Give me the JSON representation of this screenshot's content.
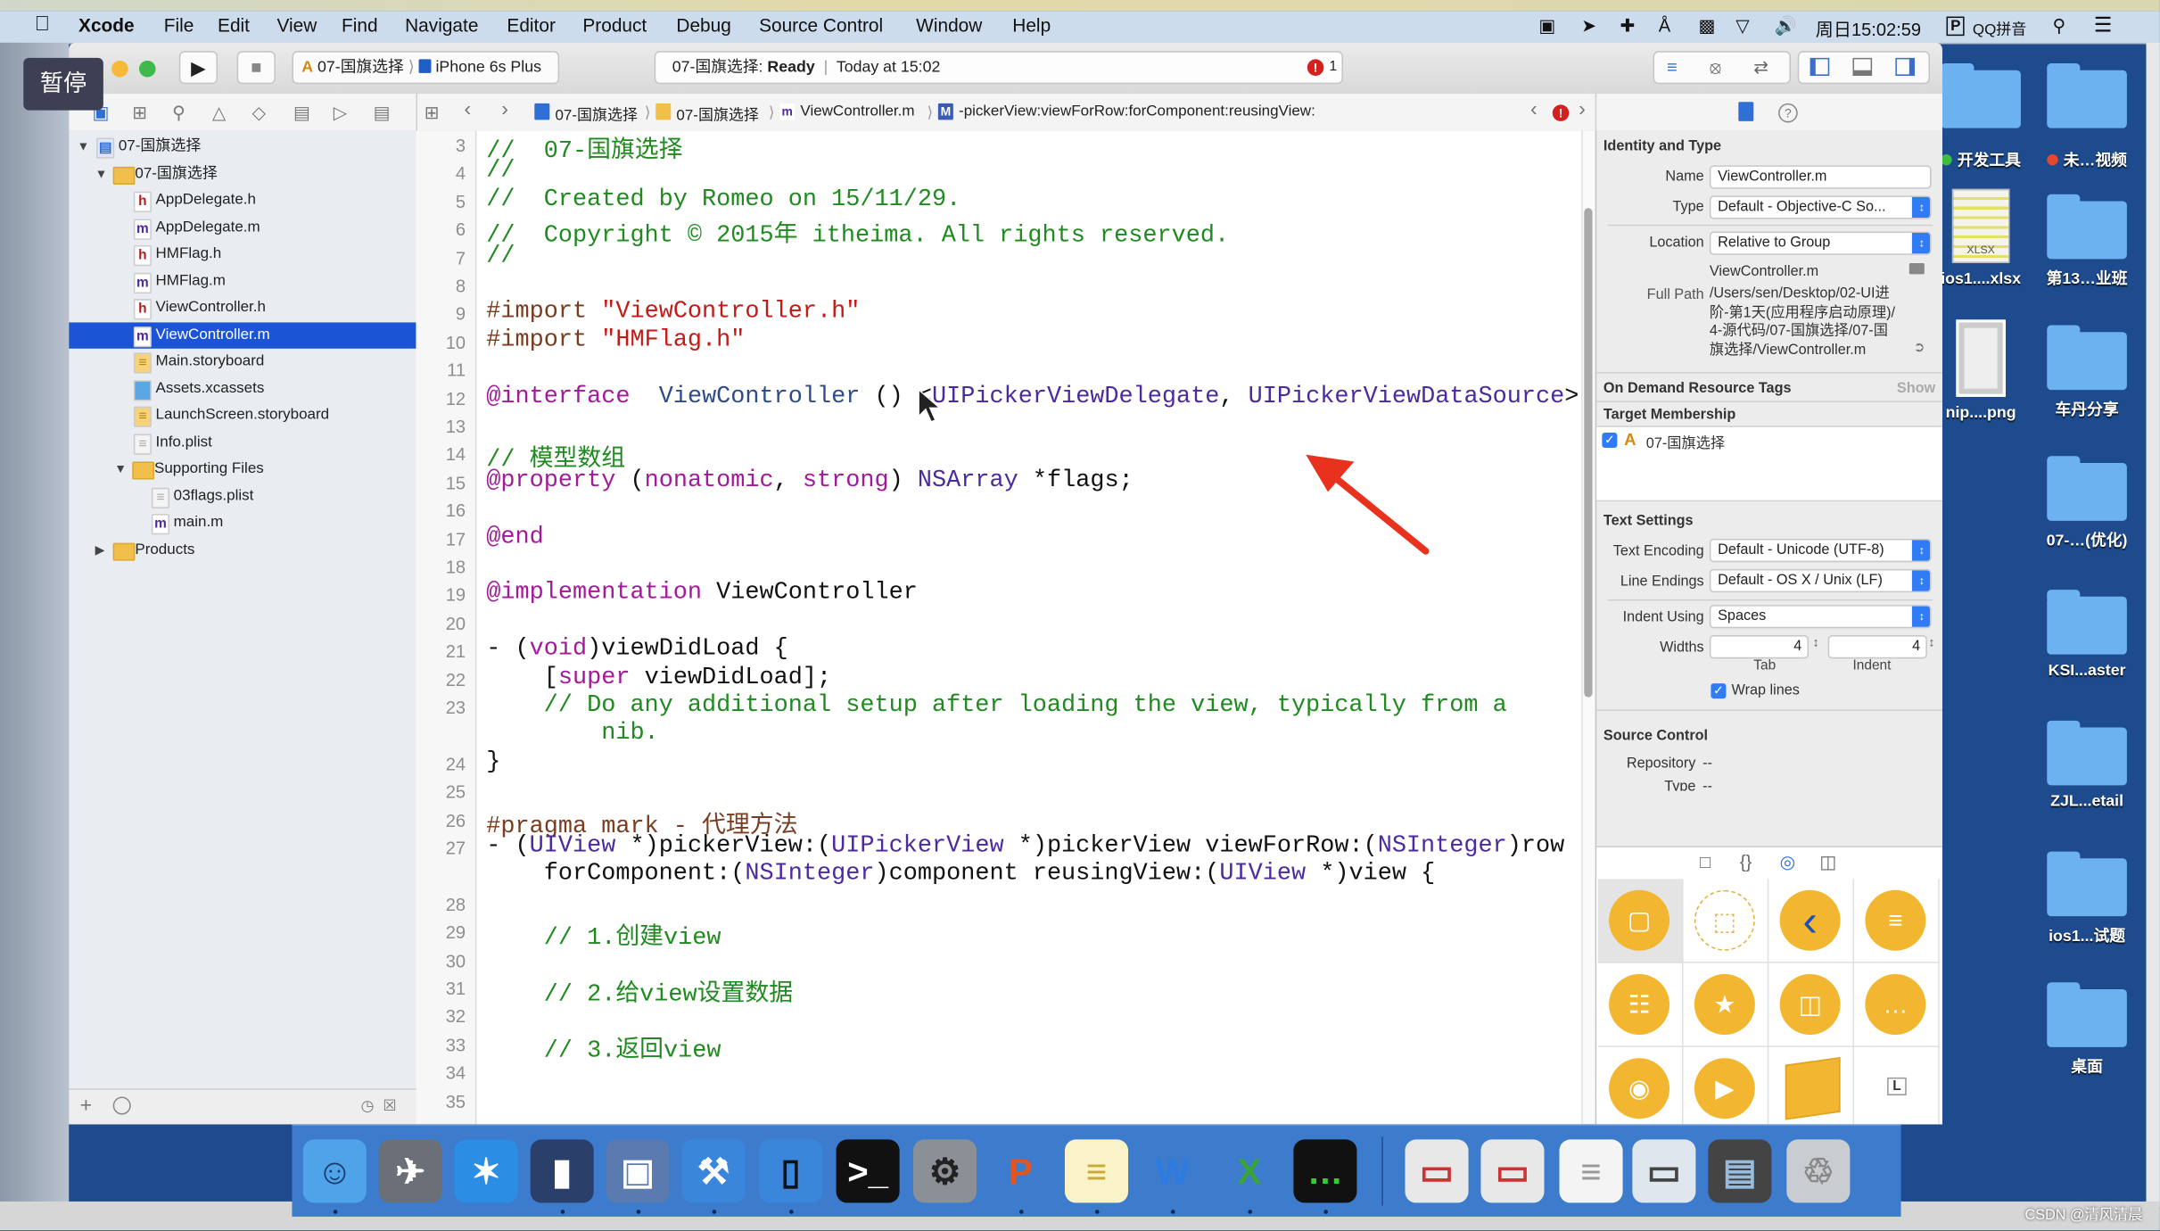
{
  "overlay": {
    "pause_label": "暂停"
  },
  "menubar": {
    "apple": "",
    "items": [
      "Xcode",
      "File",
      "Edit",
      "View",
      "Find",
      "Navigate",
      "Editor",
      "Product",
      "Debug",
      "Source Control",
      "Window",
      "Help"
    ],
    "status_icons": [
      "screen-record-icon",
      "location-icon",
      "airplane-icon",
      "bluetooth-icon",
      "lock-icon",
      "wifi-icon",
      "volume-icon"
    ],
    "clock": "周日15:02:59",
    "input_method_badge": "P",
    "input_method": "QQ拼音",
    "search_icon": "search-icon",
    "list_icon": "notification-list-icon"
  },
  "toolbar": {
    "scheme": "07-国旗选择",
    "device": "iPhone 6s Plus",
    "status_project": "07-国旗选择:",
    "status_state": "Ready",
    "status_time": "Today at 15:02",
    "error_count": "1"
  },
  "jumpbar": {
    "crumbs": [
      "07-国旗选择",
      "07-国旗选择",
      "ViewController.m",
      "-pickerView:viewForRow:forComponent:reusingView:"
    ],
    "method_badge": "M",
    "file_badge": "m"
  },
  "navigator": {
    "items": [
      {
        "label": "07-国旗选择",
        "kind": "project",
        "level": 0,
        "disclosure": "open"
      },
      {
        "label": "07-国旗选择",
        "kind": "folder",
        "level": 1,
        "disclosure": "open"
      },
      {
        "label": "AppDelegate.h",
        "kind": "h",
        "level": 2
      },
      {
        "label": "AppDelegate.m",
        "kind": "m",
        "level": 2
      },
      {
        "label": "HMFlag.h",
        "kind": "h",
        "level": 2
      },
      {
        "label": "HMFlag.m",
        "kind": "m",
        "level": 2
      },
      {
        "label": "ViewController.h",
        "kind": "h",
        "level": 2
      },
      {
        "label": "ViewController.m",
        "kind": "m",
        "level": 2,
        "selected": true
      },
      {
        "label": "Main.storyboard",
        "kind": "storyboard",
        "level": 2
      },
      {
        "label": "Assets.xcassets",
        "kind": "assets",
        "level": 2
      },
      {
        "label": "LaunchScreen.storyboard",
        "kind": "storyboard",
        "level": 2
      },
      {
        "label": "Info.plist",
        "kind": "plist",
        "level": 2
      },
      {
        "label": "Supporting Files",
        "kind": "folder",
        "level": 2,
        "disclosure": "open"
      },
      {
        "label": "03flags.plist",
        "kind": "plist",
        "level": 3
      },
      {
        "label": "main.m",
        "kind": "m",
        "level": 3
      },
      {
        "label": "Products",
        "kind": "folder",
        "level": 1,
        "disclosure": "closed"
      }
    ]
  },
  "editor": {
    "lines": [
      {
        "n": "3",
        "seg": [
          [
            "c",
            "//  07-国旗选择"
          ]
        ]
      },
      {
        "n": "4",
        "seg": [
          [
            "c",
            "//"
          ]
        ]
      },
      {
        "n": "5",
        "seg": [
          [
            "c",
            "//  Created by Romeo on 15/11/29."
          ]
        ]
      },
      {
        "n": "6",
        "seg": [
          [
            "c",
            "//  Copyright © 2015年 itheima. All rights reserved."
          ]
        ]
      },
      {
        "n": "7",
        "seg": [
          [
            "c",
            "//"
          ]
        ]
      },
      {
        "n": "8",
        "seg": []
      },
      {
        "n": "9",
        "seg": [
          [
            "p",
            "#import "
          ],
          [
            "s",
            "\"ViewController.h\""
          ]
        ]
      },
      {
        "n": "10",
        "seg": [
          [
            "p",
            "#import "
          ],
          [
            "s",
            "\"HMFlag.h\""
          ]
        ]
      },
      {
        "n": "11",
        "seg": []
      },
      {
        "n": "12",
        "seg": [
          [
            "k",
            "@interface"
          ],
          [
            "",
            "  "
          ],
          [
            "n",
            "ViewController"
          ],
          [
            "",
            " () <"
          ],
          [
            "t",
            "UIPickerViewDelegate"
          ],
          [
            "",
            ", "
          ],
          [
            "t",
            "UIPickerViewDataSource"
          ],
          [
            "",
            ">"
          ]
        ]
      },
      {
        "n": "13",
        "seg": []
      },
      {
        "n": "14",
        "seg": [
          [
            "c",
            "// 模型数组"
          ]
        ]
      },
      {
        "n": "15",
        "seg": [
          [
            "k",
            "@property"
          ],
          [
            "",
            " ("
          ],
          [
            "k",
            "nonatomic"
          ],
          [
            "",
            ", "
          ],
          [
            "k",
            "strong"
          ],
          [
            "",
            ") "
          ],
          [
            "t",
            "NSArray"
          ],
          [
            "",
            " *flags;"
          ]
        ]
      },
      {
        "n": "16",
        "seg": []
      },
      {
        "n": "17",
        "seg": [
          [
            "k",
            "@end"
          ]
        ]
      },
      {
        "n": "18",
        "seg": []
      },
      {
        "n": "19",
        "seg": [
          [
            "k",
            "@implementation"
          ],
          [
            "",
            " ViewController"
          ]
        ]
      },
      {
        "n": "20",
        "seg": []
      },
      {
        "n": "21",
        "seg": [
          [
            "",
            "- ("
          ],
          [
            "k",
            "void"
          ],
          [
            "",
            ")viewDidLoad {"
          ]
        ]
      },
      {
        "n": "22",
        "seg": [
          [
            "",
            "    ["
          ],
          [
            "k",
            "super"
          ],
          [
            "",
            " viewDidLoad];"
          ]
        ]
      },
      {
        "n": "23",
        "seg": [
          [
            "c",
            "    // Do any additional setup after loading the view, typically from a"
          ]
        ],
        "cont": [
          [
            "c",
            "        nib."
          ]
        ]
      },
      {
        "n": "24",
        "seg": [
          [
            "",
            "}"
          ]
        ]
      },
      {
        "n": "25",
        "seg": []
      },
      {
        "n": "26",
        "seg": [
          [
            "p",
            "#pragma mark - 代理方法"
          ]
        ]
      },
      {
        "n": "27",
        "seg": [
          [
            "",
            "- ("
          ],
          [
            "t",
            "UIView"
          ],
          [
            "",
            " *)pickerView:("
          ],
          [
            "t",
            "UIPickerView"
          ],
          [
            "",
            " *)pickerView viewForRow:("
          ],
          [
            "t",
            "NSInteger"
          ],
          [
            "",
            ")row"
          ]
        ],
        "cont": [
          [
            "",
            "    forComponent:("
          ],
          [
            "t",
            "NSInteger"
          ],
          [
            "",
            ")component reusingView:("
          ],
          [
            "t",
            "UIView"
          ],
          [
            "",
            " *)view {"
          ]
        ]
      },
      {
        "n": "28",
        "seg": []
      },
      {
        "n": "29",
        "seg": [
          [
            "c",
            "    // 1.创建view"
          ]
        ]
      },
      {
        "n": "30",
        "seg": []
      },
      {
        "n": "31",
        "seg": [
          [
            "c",
            "    // 2.给view设置数据"
          ]
        ]
      },
      {
        "n": "32",
        "seg": []
      },
      {
        "n": "33",
        "seg": [
          [
            "c",
            "    // 3.返回view"
          ]
        ]
      },
      {
        "n": "34",
        "seg": []
      },
      {
        "n": "35",
        "seg": []
      }
    ]
  },
  "inspector": {
    "identity_header": "Identity and Type",
    "name_label": "Name",
    "name_value": "ViewController.m",
    "type_label": "Type",
    "type_value": "Default - Objective-C So...",
    "location_label": "Location",
    "location_value": "Relative to Group",
    "location_file": "ViewController.m",
    "fullpath_label": "Full Path",
    "fullpath_lines": [
      "/Users/sen/Desktop/02-UI进",
      "阶-第1天(应用程序启动原理)/",
      "4-源代码/07-国旗选择/07-国",
      "旗选择/ViewController.m"
    ],
    "odr_header": "On Demand Resource Tags",
    "odr_show": "Show",
    "target_header": "Target Membership",
    "target_name": "07-国旗选择",
    "target_checked": true,
    "text_header": "Text Settings",
    "encoding_label": "Text Encoding",
    "encoding_value": "Default - Unicode (UTF-8)",
    "endings_label": "Line Endings",
    "endings_value": "Default - OS X / Unix (LF)",
    "indent_label": "Indent Using",
    "indent_value": "Spaces",
    "widths_label": "Widths",
    "tab_value": "4",
    "indent_width_value": "4",
    "tab_caption": "Tab",
    "indent_caption": "Indent",
    "wrap_label": "Wrap lines",
    "wrap_checked": true,
    "sc_header": "Source Control",
    "repo_label": "Repository",
    "repo_value": "--",
    "sctype_label": "Type",
    "sctype_value": "--",
    "library_items": [
      "view",
      "container-view",
      "back-navigation",
      "table-view",
      "collection-view",
      "tab-bar",
      "split-view",
      "page-view",
      "button",
      "media-player",
      "object",
      "label"
    ],
    "label_glyph": "L"
  },
  "desktop": {
    "items": [
      {
        "label": "",
        "kind": "folder",
        "col": 1
      },
      {
        "label": "",
        "kind": "folder",
        "col": 2
      },
      {
        "label": "开发工具",
        "tag": "#3fbf3f",
        "col": 1
      },
      {
        "label": "未…视频",
        "tag": "#e5482e",
        "col": 2
      },
      {
        "label": "ios1....xlsx",
        "kind": "xlsx",
        "col": 1,
        "badge": "XLSX"
      },
      {
        "label": "第13…业班",
        "kind": "folder",
        "col": 2
      },
      {
        "label": "nip....png",
        "kind": "png",
        "col": 1
      },
      {
        "label": "车丹分享",
        "kind": "folder",
        "col": 2
      },
      {
        "label": "07-…(优化)",
        "kind": "folder",
        "col": 2
      },
      {
        "label": "KSI...aster",
        "kind": "folder",
        "col": 2
      },
      {
        "label": "ZJL...etail",
        "kind": "folder",
        "col": 2
      },
      {
        "label": "ios1...试题",
        "kind": "folder",
        "col": 2
      },
      {
        "label": "桌面",
        "kind": "folder",
        "col": 2
      }
    ]
  },
  "dock": {
    "apps": [
      "finder",
      "launchpad",
      "safari",
      "mouse-app",
      "photo-booth",
      "xcode",
      "simulator",
      "terminal",
      "system-preferences",
      "powerpoint",
      "notes",
      "word",
      "excel",
      "console",
      "screenshot-1",
      "screenshot-2",
      "document",
      "image-1",
      "image-2",
      "trash"
    ]
  },
  "annotation": {
    "arrow_color": "#e8321e"
  },
  "watermark": "CSDN @清风清晨"
}
